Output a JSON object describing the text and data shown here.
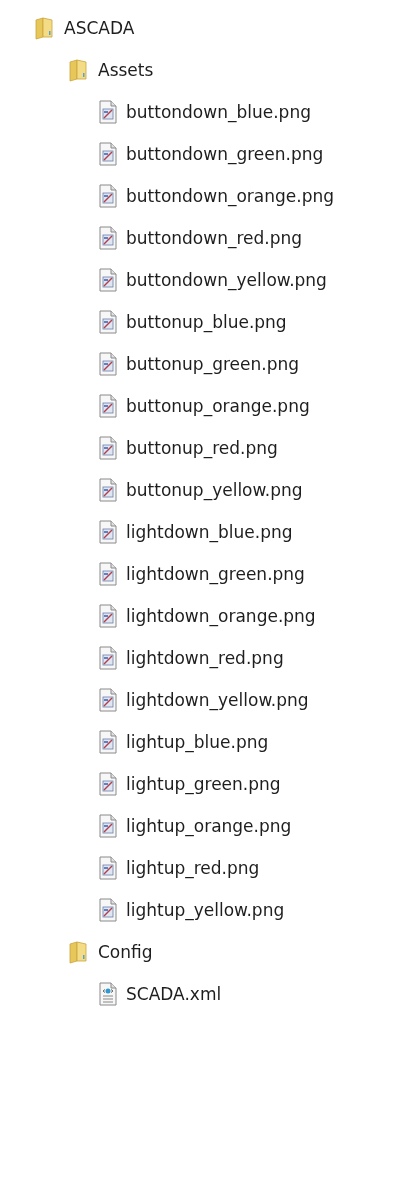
{
  "tree": [
    {
      "label": "ASCADA",
      "kind": "folder",
      "children": [
        {
          "label": "Assets",
          "kind": "folder",
          "children": [
            {
              "label": "buttondown_blue.png",
              "kind": "image"
            },
            {
              "label": "buttondown_green.png",
              "kind": "image"
            },
            {
              "label": "buttondown_orange.png",
              "kind": "image"
            },
            {
              "label": "buttondown_red.png",
              "kind": "image"
            },
            {
              "label": "buttondown_yellow.png",
              "kind": "image"
            },
            {
              "label": "buttonup_blue.png",
              "kind": "image"
            },
            {
              "label": "buttonup_green.png",
              "kind": "image"
            },
            {
              "label": "buttonup_orange.png",
              "kind": "image"
            },
            {
              "label": "buttonup_red.png",
              "kind": "image"
            },
            {
              "label": "buttonup_yellow.png",
              "kind": "image"
            },
            {
              "label": "lightdown_blue.png",
              "kind": "image"
            },
            {
              "label": "lightdown_green.png",
              "kind": "image"
            },
            {
              "label": "lightdown_orange.png",
              "kind": "image"
            },
            {
              "label": "lightdown_red.png",
              "kind": "image"
            },
            {
              "label": "lightdown_yellow.png",
              "kind": "image"
            },
            {
              "label": "lightup_blue.png",
              "kind": "image"
            },
            {
              "label": "lightup_green.png",
              "kind": "image"
            },
            {
              "label": "lightup_orange.png",
              "kind": "image"
            },
            {
              "label": "lightup_red.png",
              "kind": "image"
            },
            {
              "label": "lightup_yellow.png",
              "kind": "image"
            }
          ]
        },
        {
          "label": "Config",
          "kind": "folder",
          "children": [
            {
              "label": "SCADA.xml",
              "kind": "xml"
            }
          ]
        }
      ]
    }
  ]
}
